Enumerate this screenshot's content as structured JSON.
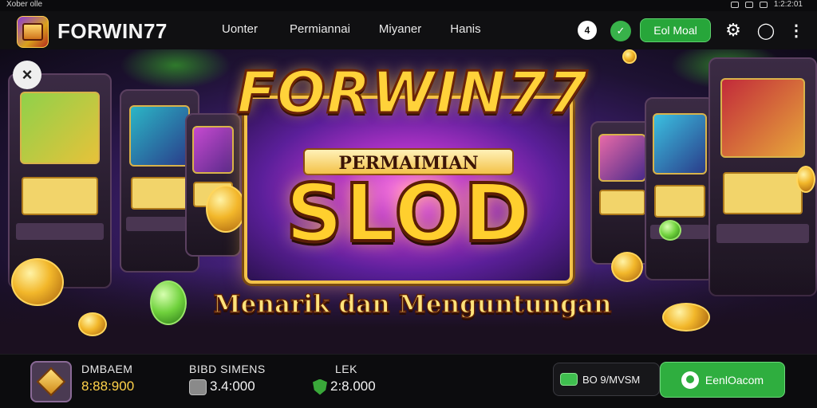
{
  "statusbar": {
    "left_text": "Xober olle",
    "right_text": "1:2:2:01"
  },
  "header": {
    "brand": "FORWIN77",
    "nav": [
      "Uonter",
      "Permiannai",
      "Miyaner",
      "Hanis"
    ],
    "wallet_icon_glyph": "4",
    "cta_label": "Eol Moal"
  },
  "hero": {
    "close_glyph": "×",
    "title": "FORWIN77",
    "subtitle": "PERMAIMIAN",
    "headline": "SLOD",
    "tagline": "Menarik dan Menguntungan"
  },
  "bottom": {
    "stat1": {
      "label": "DMBAEM",
      "value": "8:88:900"
    },
    "stat2": {
      "label": "BIBD SIMENS",
      "value": "3.4:000"
    },
    "stat3": {
      "label": "LEK",
      "value": "2:8.000"
    },
    "pill_dark": "BO 9/MVSM",
    "pill_green": "EenlOacom"
  },
  "colors": {
    "accent_green": "#2fae3f",
    "gold": "#ffd24a",
    "purple": "#5b1f9a"
  }
}
